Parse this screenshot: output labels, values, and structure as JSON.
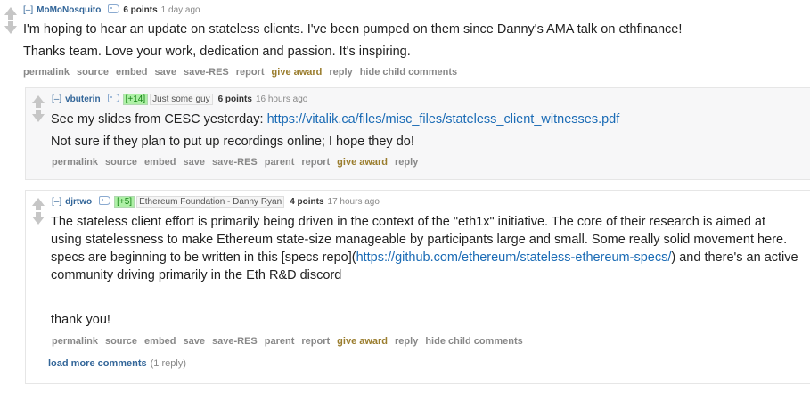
{
  "comment1": {
    "expand": "[–]",
    "author": "MoMoNosquito",
    "score": "6 points",
    "time": "1 day ago",
    "paragraphs": [
      "I'm hoping to hear an update on stateless clients. I've been pumped on them since Danny's AMA talk on ethfinance!",
      "Thanks team. Love your work, dedication and passion. It's inspiring."
    ],
    "actions": [
      "permalink",
      "source",
      "embed",
      "save",
      "save-RES",
      "report",
      "give award",
      "reply",
      "hide child comments"
    ]
  },
  "comment2": {
    "expand": "[–]",
    "author": "vbuterin",
    "karma": "[+14]",
    "flair": "Just some guy",
    "score": "6 points",
    "time": "16 hours ago",
    "line1_prefix": "See my slides from CESC yesterday: ",
    "line1_link": "https://vitalik.ca/files/misc_files/stateless_client_witnesses.pdf",
    "line2": "Not sure if they plan to put up recordings online; I hope they do!",
    "actions": [
      "permalink",
      "source",
      "embed",
      "save",
      "save-RES",
      "parent",
      "report",
      "give award",
      "reply"
    ]
  },
  "comment3": {
    "expand": "[–]",
    "author": "djrtwo",
    "karma": "[+5]",
    "flair": "Ethereum Foundation - Danny Ryan",
    "score": "4 points",
    "time": "17 hours ago",
    "para1_before": "The stateless client effort is primarily being driven in the context of the \"eth1x\" initiative. The core of their research is aimed at using statelessness to make Ethereum state-size manageable by participants large and small. Some really solid movement here. specs are beginning to be written in this [specs repo](",
    "para1_link": "https://github.com/ethereum/stateless-ethereum-specs/",
    "para1_after": ") and there's an active community driving primarily in the Eth R&D discord",
    "para2": "thank you!",
    "actions": [
      "permalink",
      "source",
      "embed",
      "save",
      "save-RES",
      "parent",
      "report",
      "give award",
      "reply",
      "hide child comments"
    ],
    "load_more": "load more comments",
    "load_more_count": "(1 reply)"
  },
  "colors": {
    "author": "#336699",
    "link": "#1a6bb5",
    "give_award": "#9a7d2e",
    "karma_bg": "#aef0a6"
  }
}
